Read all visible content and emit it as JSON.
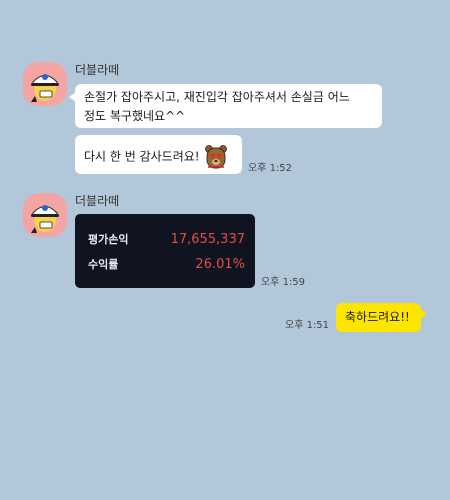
{
  "messages": [
    {
      "sender": "더블라떼",
      "avatar_icon": "character-avatar-icon",
      "lines": [
        "손절가 잡아주시고, 재진입각 잡아주셔서 손실금 어느",
        "정도 복구했네요^^"
      ],
      "second_bubble": "다시 한 번 감사드려요!",
      "emoji_icon": "bear-heart-eyes-emoji-icon",
      "time": "오후 1:52"
    },
    {
      "sender": "더블라떼",
      "avatar_icon": "character-avatar-icon",
      "card": {
        "rows": [
          {
            "label": "평가손익",
            "value": "17,655,337"
          },
          {
            "label": "수익률",
            "value": "26.01%"
          }
        ],
        "value_color": "#e24c44",
        "background": "#0f1420"
      },
      "time": "오후 1:59"
    },
    {
      "mine": true,
      "text": "축하드려요!!",
      "time": "오후 1:51",
      "bubble_color": "#fee500"
    }
  ],
  "colors": {
    "background": "#b2c7da",
    "avatar_bg": "#f2a5a2"
  }
}
